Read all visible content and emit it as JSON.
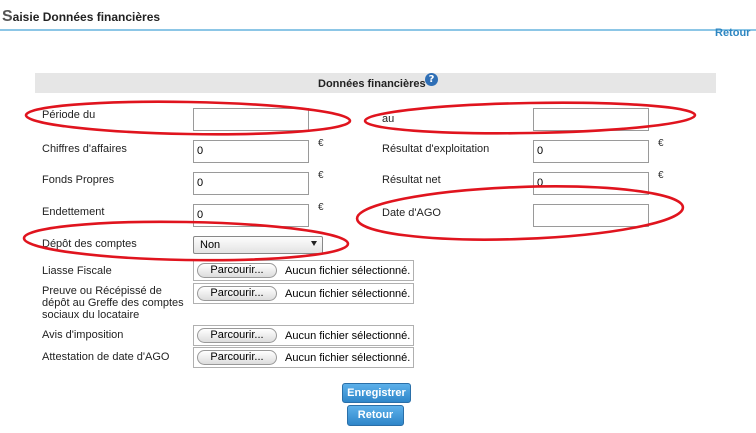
{
  "header": {
    "title_first_letter": "S",
    "title_rest": "aisie Données financières",
    "back_link": "Retour"
  },
  "section": {
    "title": "Données financières",
    "help_icon": "help-question-icon"
  },
  "fields": {
    "periode_du": {
      "label": "Période du",
      "value": ""
    },
    "au": {
      "label": "au",
      "value": ""
    },
    "chiffre_affaires": {
      "label": "Chiffres d'affaires",
      "value": "0",
      "unit": "€"
    },
    "resultat_exploitation": {
      "label": "Résultat d'exploitation",
      "value": "0",
      "unit": "€"
    },
    "fonds_propres": {
      "label": "Fonds Propres",
      "value": "0",
      "unit": "€"
    },
    "resultat_net": {
      "label": "Résultat net",
      "value": "0",
      "unit": "€"
    },
    "endettement": {
      "label": "Endettement",
      "value": "0",
      "unit": "€"
    },
    "date_ago": {
      "label": "Date d'AGO",
      "value": ""
    },
    "depot_comptes": {
      "label": "Dépôt des comptes",
      "selected": "Non"
    }
  },
  "files": [
    {
      "label_lines": [
        "Liasse Fiscale"
      ],
      "button": "Parcourir...",
      "status": "Aucun fichier sélectionné."
    },
    {
      "label_lines": [
        "Preuve ou Récépissé de",
        "dépôt au Greffe des comptes",
        "sociaux du locataire"
      ],
      "button": "Parcourir...",
      "status": "Aucun fichier sélectionné."
    },
    {
      "label_lines": [
        "Avis d'imposition"
      ],
      "button": "Parcourir...",
      "status": "Aucun fichier sélectionné."
    },
    {
      "label_lines": [
        "Attestation de date d'AGO"
      ],
      "button": "Parcourir...",
      "status": "Aucun fichier sélectionné."
    }
  ],
  "actions": {
    "save": "Enregistrer",
    "back": "Retour"
  },
  "colors": {
    "accent_blue": "#2e86c1",
    "annotation_red": "#e0141e",
    "header_bar": "#e6e6e6"
  }
}
